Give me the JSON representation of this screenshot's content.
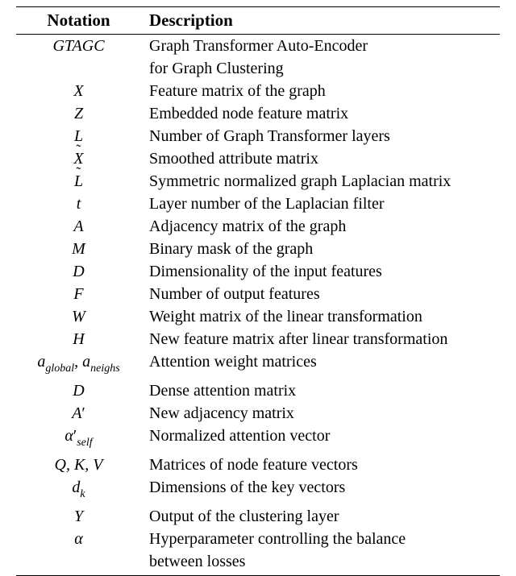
{
  "headers": {
    "notation": "Notation",
    "description": "Description"
  },
  "rows": [
    {
      "notation_html": "GTAGC",
      "desc": "Graph Transformer Auto-Encoder"
    },
    {
      "notation_html": "",
      "desc": "for Graph Clustering"
    },
    {
      "notation_html": "X",
      "desc": "Feature matrix of the graph"
    },
    {
      "notation_html": "Z",
      "desc": "Embedded node feature matrix"
    },
    {
      "notation_html": "L",
      "desc": "Number of Graph Transformer layers"
    },
    {
      "notation_html": "<span class='tilde-wrap'><span class='tilde'>˜</span>X</span>",
      "desc": "Smoothed attribute matrix"
    },
    {
      "notation_html": "<span class='tilde-wrap'><span class='tilde'>˜</span>L</span>",
      "desc": "Symmetric normalized graph Laplacian matrix"
    },
    {
      "notation_html": "t",
      "desc": "Layer number of the Laplacian filter"
    },
    {
      "notation_html": "A",
      "desc": "Adjacency matrix of the graph"
    },
    {
      "notation_html": "M",
      "desc": "Binary mask of the graph"
    },
    {
      "notation_html": "D",
      "desc": "Dimensionality of the input features"
    },
    {
      "notation_html": "F",
      "desc": "Number of output features"
    },
    {
      "notation_html": "W",
      "desc": "Weight matrix of the linear transformation"
    },
    {
      "notation_html": "H",
      "desc": "New feature matrix after linear transformation"
    },
    {
      "notation_html": "a<span class='sub'>global</span>, a<span class='sub'>neighs</span>",
      "desc": "Attention weight matrices"
    },
    {
      "notation_html": "D",
      "desc": "Dense attention matrix"
    },
    {
      "notation_html": "A<span class='prime'>′</span>",
      "desc": "New adjacency matrix"
    },
    {
      "notation_html": "α<span class='prime'>′</span><span class='sub'>self</span>",
      "desc": "Normalized attention vector"
    },
    {
      "notation_html": "Q, K, V",
      "desc": "Matrices of node feature vectors"
    },
    {
      "notation_html": "d<span class='sub'>k</span>",
      "desc": "Dimensions of the key vectors"
    },
    {
      "notation_html": "Y",
      "desc": "Output of the clustering layer"
    },
    {
      "notation_html": "α",
      "desc": "Hyperparameter controlling the balance"
    },
    {
      "notation_html": "",
      "desc": "between losses"
    }
  ]
}
